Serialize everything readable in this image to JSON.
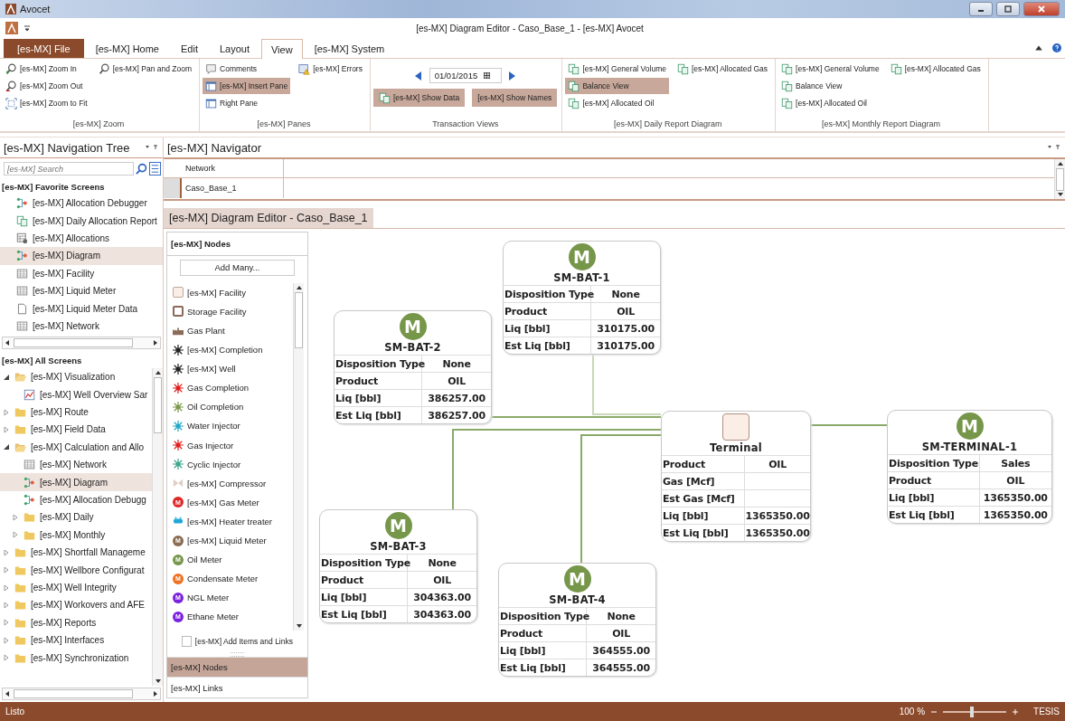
{
  "window": {
    "title": "Avocet",
    "document_title": "[es-MX] Diagram Editor - Caso_Base_1 - [es-MX] Avocet"
  },
  "ribbon_tabs": [
    {
      "label": "[es-MX] File",
      "kind": "file",
      "selected": false
    },
    {
      "label": "[es-MX] Home",
      "kind": "tab",
      "selected": false
    },
    {
      "label": "Edit",
      "kind": "tab",
      "selected": false
    },
    {
      "label": "Layout",
      "kind": "tab",
      "selected": false
    },
    {
      "label": "View",
      "kind": "tab",
      "selected": true
    },
    {
      "label": "[es-MX] System",
      "kind": "tab",
      "selected": false
    }
  ],
  "ribbon_groups": [
    {
      "kind": "buttons",
      "label": "[es-MX] Zoom",
      "columns": [
        [
          {
            "label": "[es-MX] Zoom In",
            "kind": "zoom-in",
            "selected": false
          },
          {
            "label": "[es-MX] Zoom Out",
            "kind": "zoom-out",
            "selected": false
          },
          {
            "label": "[es-MX] Zoom to Fit",
            "kind": "fit",
            "selected": false
          }
        ],
        [
          {
            "label": "[es-MX] Pan and Zoom",
            "kind": "pan",
            "selected": false
          }
        ]
      ]
    },
    {
      "kind": "buttons",
      "label": "[es-MX] Panes",
      "columns": [
        [
          {
            "label": "Comments",
            "kind": "comments",
            "selected": false
          },
          {
            "label": "[es-MX] Insert Pane",
            "kind": "pane",
            "selected": true
          },
          {
            "label": "Right Pane",
            "kind": "pane",
            "selected": false
          }
        ],
        [
          {
            "label": "[es-MX] Errors",
            "kind": "errors",
            "selected": false
          }
        ]
      ]
    },
    {
      "kind": "date",
      "label": "Transaction Views",
      "date": "01/01/2015",
      "buttons": [
        {
          "label": "[es-MX] Show Data",
          "kind": "report",
          "selected": true
        },
        {
          "label": "[es-MX] Show Names",
          "kind": "text",
          "selected": true
        }
      ]
    },
    {
      "kind": "buttons",
      "label": "[es-MX] Daily Report Diagram",
      "columns": [
        [
          {
            "label": "[es-MX] General Volume",
            "kind": "report",
            "selected": false
          },
          {
            "label": "Balance View",
            "kind": "report",
            "selected": true
          },
          {
            "label": "[es-MX] Allocated Oil",
            "kind": "report",
            "selected": false
          }
        ],
        [
          {
            "label": "[es-MX] Allocated Gas",
            "kind": "report",
            "selected": false
          }
        ]
      ]
    },
    {
      "kind": "buttons",
      "label": "[es-MX] Monthly Report Diagram",
      "columns": [
        [
          {
            "label": "[es-MX] General Volume",
            "kind": "report",
            "selected": false
          },
          {
            "label": "Balance View",
            "kind": "report",
            "selected": false
          },
          {
            "label": "[es-MX] Allocated Oil",
            "kind": "report",
            "selected": false
          }
        ],
        [
          {
            "label": "[es-MX] Allocated Gas",
            "kind": "report",
            "selected": false
          }
        ]
      ]
    }
  ],
  "navigation_tree": {
    "title": "[es-MX] Navigation Tree",
    "search": {
      "placeholder": "[es-MX] Search"
    },
    "favorites": {
      "title": "[es-MX] Favorite Screens",
      "items": [
        {
          "label": "[es-MX] Allocation Debugger",
          "kind": "diagram",
          "selected": false
        },
        {
          "label": "[es-MX] Daily Allocation Report",
          "kind": "report",
          "selected": false
        },
        {
          "label": "[es-MX] Allocations",
          "kind": "allocations",
          "selected": false
        },
        {
          "label": "[es-MX] Diagram",
          "kind": "diagram",
          "selected": true
        },
        {
          "label": "[es-MX] Facility",
          "kind": "grid",
          "selected": false
        },
        {
          "label": "[es-MX] Liquid Meter",
          "kind": "grid",
          "selected": false
        },
        {
          "label": "[es-MX] Liquid Meter Data",
          "kind": "page",
          "selected": false
        },
        {
          "label": "[es-MX] Network",
          "kind": "grid",
          "selected": false
        }
      ]
    },
    "all_screens": {
      "title": "[es-MX] All Screens",
      "items": [
        {
          "label": "[es-MX] Visualization",
          "kind": "folder",
          "expanded": true,
          "selected": false,
          "children": [
            {
              "label": "[es-MX] Well Overview Sar",
              "kind": "chart",
              "selected": false
            }
          ]
        },
        {
          "label": "[es-MX] Route",
          "kind": "folder",
          "expanded": false,
          "selected": false
        },
        {
          "label": "[es-MX] Field Data",
          "kind": "folder",
          "expanded": false,
          "selected": false
        },
        {
          "label": "[es-MX] Calculation and Allo",
          "kind": "folder",
          "expanded": true,
          "selected": false,
          "children": [
            {
              "label": "[es-MX] Network",
              "kind": "grid",
              "selected": false
            },
            {
              "label": "[es-MX] Diagram",
              "kind": "diagram",
              "selected": true
            },
            {
              "label": "[es-MX] Allocation Debugg",
              "kind": "diagram",
              "selected": false
            },
            {
              "label": "[es-MX] Daily",
              "kind": "folder",
              "expanded": false,
              "selected": false
            },
            {
              "label": "[es-MX] Monthly",
              "kind": "folder",
              "expanded": false,
              "selected": false
            }
          ]
        },
        {
          "label": "[es-MX] Shortfall Manageme",
          "kind": "folder",
          "expanded": false,
          "selected": false
        },
        {
          "label": "[es-MX] Wellbore Configurat",
          "kind": "folder",
          "expanded": false,
          "selected": false
        },
        {
          "label": "[es-MX] Well Integrity",
          "kind": "folder",
          "expanded": false,
          "selected": false
        },
        {
          "label": "[es-MX] Workovers and AFE",
          "kind": "folder",
          "expanded": false,
          "selected": false
        },
        {
          "label": "[es-MX] Reports",
          "kind": "folder",
          "expanded": false,
          "selected": false
        },
        {
          "label": "[es-MX] Interfaces",
          "kind": "folder",
          "expanded": false,
          "selected": false
        },
        {
          "label": "[es-MX] Synchronization",
          "kind": "folder",
          "expanded": false,
          "selected": false
        }
      ]
    }
  },
  "navigator": {
    "title": "[es-MX] Navigator",
    "column": "Network",
    "rows": [
      {
        "label": "Caso_Base_1"
      }
    ]
  },
  "editor": {
    "title": "[es-MX] Diagram Editor - Caso_Base_1",
    "palette": {
      "title": "[es-MX] Nodes",
      "add_button": "Add Many...",
      "items": [
        {
          "label": "[es-MX] Facility",
          "kind": "facility"
        },
        {
          "label": "Storage Facility",
          "kind": "storage"
        },
        {
          "label": "Gas Plant",
          "kind": "plant"
        },
        {
          "label": "[es-MX] Completion",
          "kind": "burst",
          "color": "#222222"
        },
        {
          "label": "[es-MX] Well",
          "kind": "burst",
          "color": "#222222"
        },
        {
          "label": "Gas Completion",
          "kind": "burst",
          "color": "#e02020"
        },
        {
          "label": "Oil Completion",
          "kind": "burst",
          "color": "#7a9a4a"
        },
        {
          "label": "Water Injector",
          "kind": "burst",
          "color": "#20a8c8"
        },
        {
          "label": "Gas Injector",
          "kind": "burst",
          "color": "#e02020"
        },
        {
          "label": "Cyclic Injector",
          "kind": "burst",
          "color": "#3aa88a"
        },
        {
          "label": "[es-MX] Compressor",
          "kind": "compressor"
        },
        {
          "label": "[es-MX] Gas Meter",
          "kind": "meter",
          "badge": "M",
          "color": "#e02828"
        },
        {
          "label": "[es-MX] Heater treater",
          "kind": "heater"
        },
        {
          "label": "[es-MX] Liquid Meter",
          "kind": "meter",
          "badge": "M",
          "color": "#8a6a50"
        },
        {
          "label": "Oil Meter",
          "kind": "meter",
          "badge": "M",
          "color": "#76964a"
        },
        {
          "label": "Condensate Meter",
          "kind": "meter",
          "badge": "M",
          "color": "#f07020"
        },
        {
          "label": "NGL Meter",
          "kind": "meter",
          "badge": "M",
          "color": "#7a20e0"
        },
        {
          "label": "Ethane Meter",
          "kind": "meter",
          "badge": "M",
          "color": "#7a20e0"
        }
      ],
      "checkbox": {
        "label": "[es-MX] Add Items and Links",
        "checked": false
      },
      "tabs": [
        {
          "label": "[es-MX] Nodes",
          "selected": true
        },
        {
          "label": "[es-MX] Links",
          "selected": false
        }
      ]
    },
    "nodes": [
      {
        "name": "SM-BAT-1",
        "kind": "meter",
        "badge": "M",
        "rows": [
          {
            "label": "Disposition Type",
            "value": "None"
          },
          {
            "label": "Product",
            "value": "OIL"
          },
          {
            "label": "Liq [bbl]",
            "value": "310175.00"
          },
          {
            "label": "Est Liq [bbl]",
            "value": "310175.00"
          }
        ]
      },
      {
        "name": "SM-BAT-2",
        "kind": "meter",
        "badge": "M",
        "rows": [
          {
            "label": "Disposition Type",
            "value": "None"
          },
          {
            "label": "Product",
            "value": "OIL"
          },
          {
            "label": "Liq [bbl]",
            "value": "386257.00"
          },
          {
            "label": "Est Liq [bbl]",
            "value": "386257.00"
          }
        ]
      },
      {
        "name": "SM-BAT-3",
        "kind": "meter",
        "badge": "M",
        "rows": [
          {
            "label": "Disposition Type",
            "value": "None"
          },
          {
            "label": "Product",
            "value": "OIL"
          },
          {
            "label": "Liq [bbl]",
            "value": "304363.00"
          },
          {
            "label": "Est Liq [bbl]",
            "value": "304363.00"
          }
        ]
      },
      {
        "name": "SM-BAT-4",
        "kind": "meter",
        "badge": "M",
        "rows": [
          {
            "label": "Disposition Type",
            "value": "None"
          },
          {
            "label": "Product",
            "value": "OIL"
          },
          {
            "label": "Liq [bbl]",
            "value": "364555.00"
          },
          {
            "label": "Est Liq [bbl]",
            "value": "364555.00"
          }
        ]
      },
      {
        "name": "Terminal",
        "kind": "facility",
        "rows": [
          {
            "label": "Product",
            "value": "OIL"
          },
          {
            "label": "Gas [Mcf]"
          },
          {
            "label": "Est Gas [Mcf]"
          },
          {
            "label": "Liq [bbl]",
            "value": "1365350.00"
          },
          {
            "label": "Est Liq [bbl]",
            "value": "1365350.00"
          }
        ]
      },
      {
        "name": "SM-TERMINAL-1",
        "kind": "meter",
        "badge": "M",
        "rows": [
          {
            "label": "Disposition Type",
            "value": "Sales"
          },
          {
            "label": "Product",
            "value": "OIL"
          },
          {
            "label": "Liq [bbl]",
            "value": "1365350.00"
          },
          {
            "label": "Est Liq [bbl]",
            "value": "1365350.00"
          }
        ]
      }
    ]
  },
  "status_bar": {
    "text": "Listo",
    "zoom": "100 %",
    "zoom_slider": {
      "level": 0.45
    },
    "user": "TESIS"
  }
}
